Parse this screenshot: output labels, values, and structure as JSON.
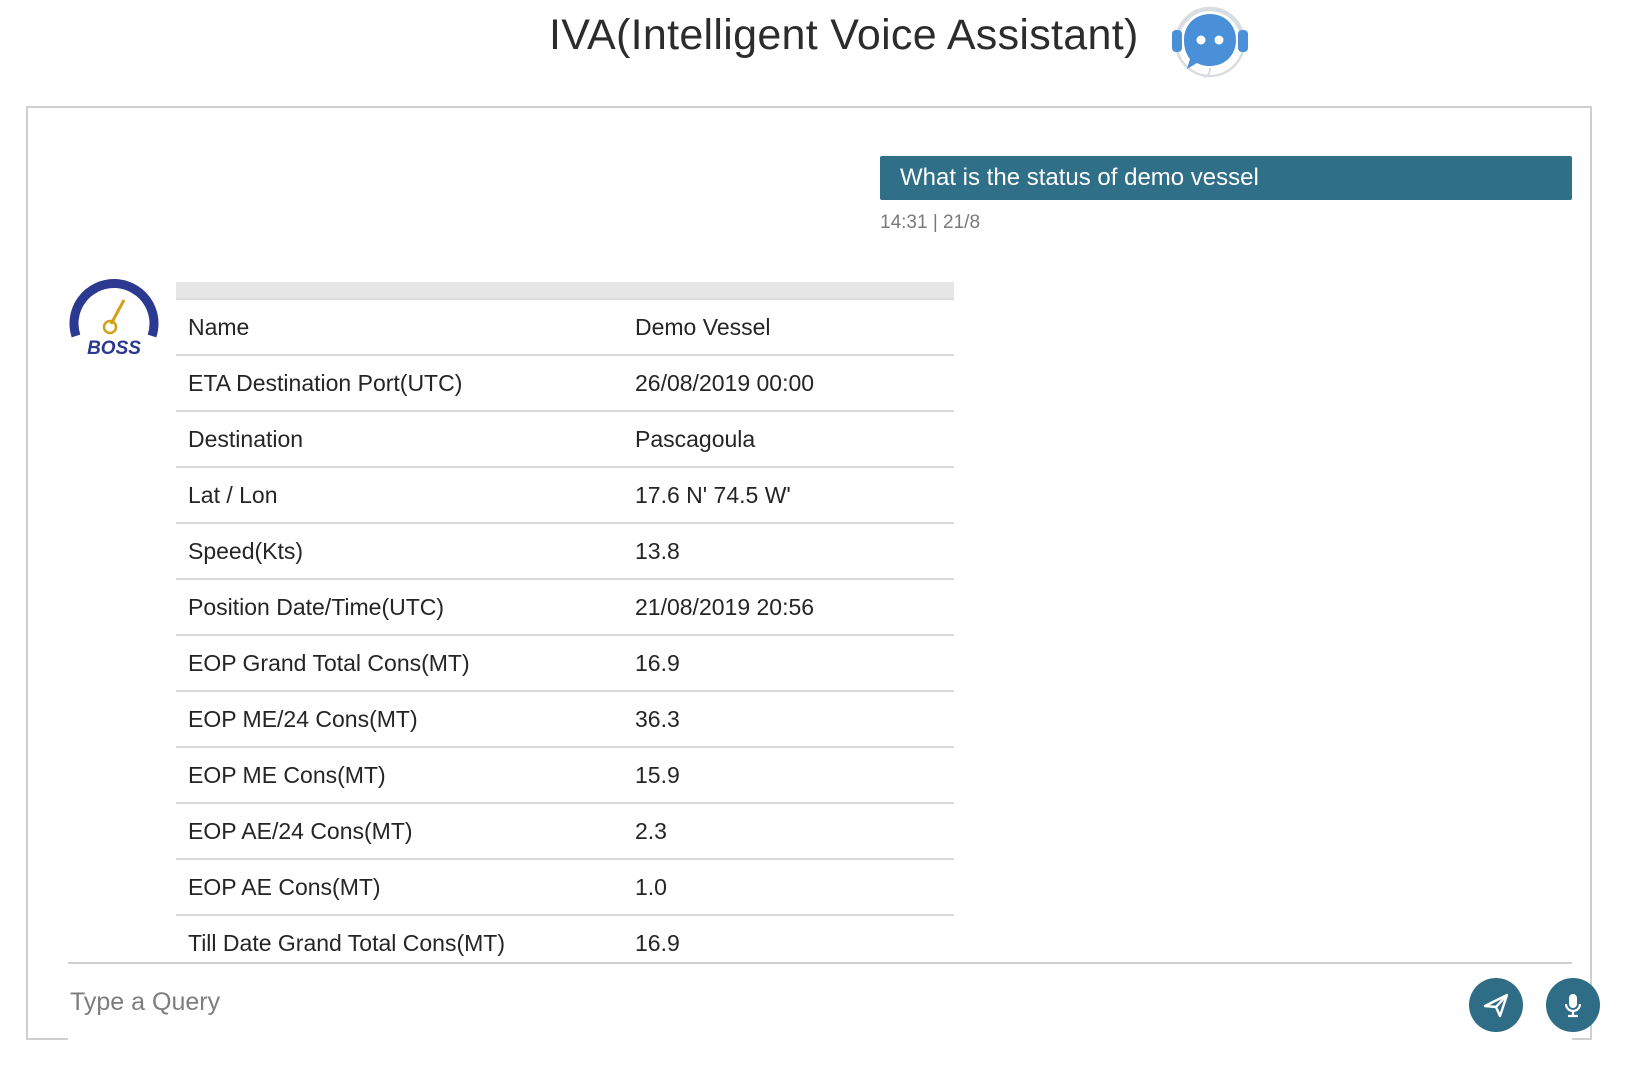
{
  "header": {
    "title": "IVA(Intelligent Voice Assistant)",
    "icon": "chatbot-headset-icon"
  },
  "conversation": {
    "user_message": {
      "text": "What is the status of demo vessel",
      "timestamp": "14:31 | 21/8"
    },
    "bot_reply": {
      "avatar": "boss-logo",
      "avatar_text": "BOSS",
      "rows": [
        {
          "label": "Name",
          "value": "Demo Vessel"
        },
        {
          "label": "ETA Destination Port(UTC)",
          "value": "26/08/2019 00:00"
        },
        {
          "label": "Destination",
          "value": "Pascagoula"
        },
        {
          "label": "Lat / Lon",
          "value": "17.6 N' 74.5 W'"
        },
        {
          "label": "Speed(Kts)",
          "value": "13.8"
        },
        {
          "label": "Position Date/Time(UTC)",
          "value": "21/08/2019 20:56"
        },
        {
          "label": "EOP Grand Total Cons(MT)",
          "value": "16.9"
        },
        {
          "label": "EOP ME/24 Cons(MT)",
          "value": "36.3"
        },
        {
          "label": "EOP ME Cons(MT)",
          "value": "15.9"
        },
        {
          "label": "EOP AE/24 Cons(MT)",
          "value": "2.3"
        },
        {
          "label": "EOP AE Cons(MT)",
          "value": "1.0"
        },
        {
          "label": "Till Date Grand Total Cons(MT)",
          "value": "16.9"
        }
      ]
    }
  },
  "input": {
    "placeholder": "Type a Query",
    "value": "",
    "send_icon": "send-icon",
    "mic_icon": "microphone-icon"
  },
  "colors": {
    "accent": "#306f88",
    "bot_icon": "#4a90d9",
    "logo_blue": "#2b3990",
    "logo_gold": "#d4a017"
  }
}
